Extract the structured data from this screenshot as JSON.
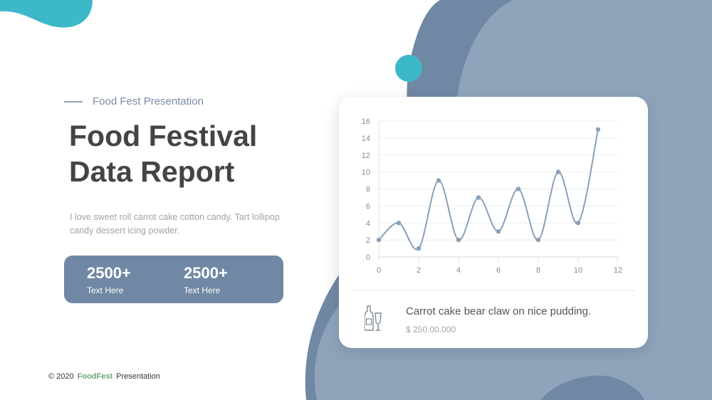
{
  "tagline": "Food Fest Presentation",
  "title_lines": [
    "Food Festival",
    "Data Report"
  ],
  "description": "I love sweet roll carrot cake cotton candy. Tart lollipop candy dessert icing powder.",
  "stats": [
    {
      "value": "2500+",
      "label": "Text Here"
    },
    {
      "value": "2500+",
      "label": "Text Here"
    }
  ],
  "card": {
    "title": "Carrot cake bear claw on nice pudding.",
    "price": "$ 250.00.000",
    "icon": "bottle-glass-icon"
  },
  "footer": {
    "copyright": "© 2020",
    "brand": "FoodFest",
    "suffix": "Presentation"
  },
  "colors": {
    "accent_teal": "#3db8c9",
    "shape_dark": "#7088a4",
    "shape_light": "#8fa4bb",
    "line": "#8aa0b8",
    "title": "#444444",
    "brand_green": "#6aa47a"
  },
  "chart_data": {
    "type": "line",
    "x": [
      0,
      1,
      2,
      3,
      4,
      5,
      6,
      7,
      8,
      9,
      10,
      11
    ],
    "values": [
      2,
      4,
      1,
      9,
      2,
      7,
      3,
      8,
      2,
      10,
      4,
      15
    ],
    "xlim": [
      0,
      12
    ],
    "ylim": [
      0,
      16
    ],
    "xticks": [
      0,
      2,
      4,
      6,
      8,
      10,
      12
    ],
    "yticks": [
      0,
      2,
      4,
      6,
      8,
      10,
      12,
      14,
      16
    ],
    "grid": true,
    "smooth": true
  }
}
